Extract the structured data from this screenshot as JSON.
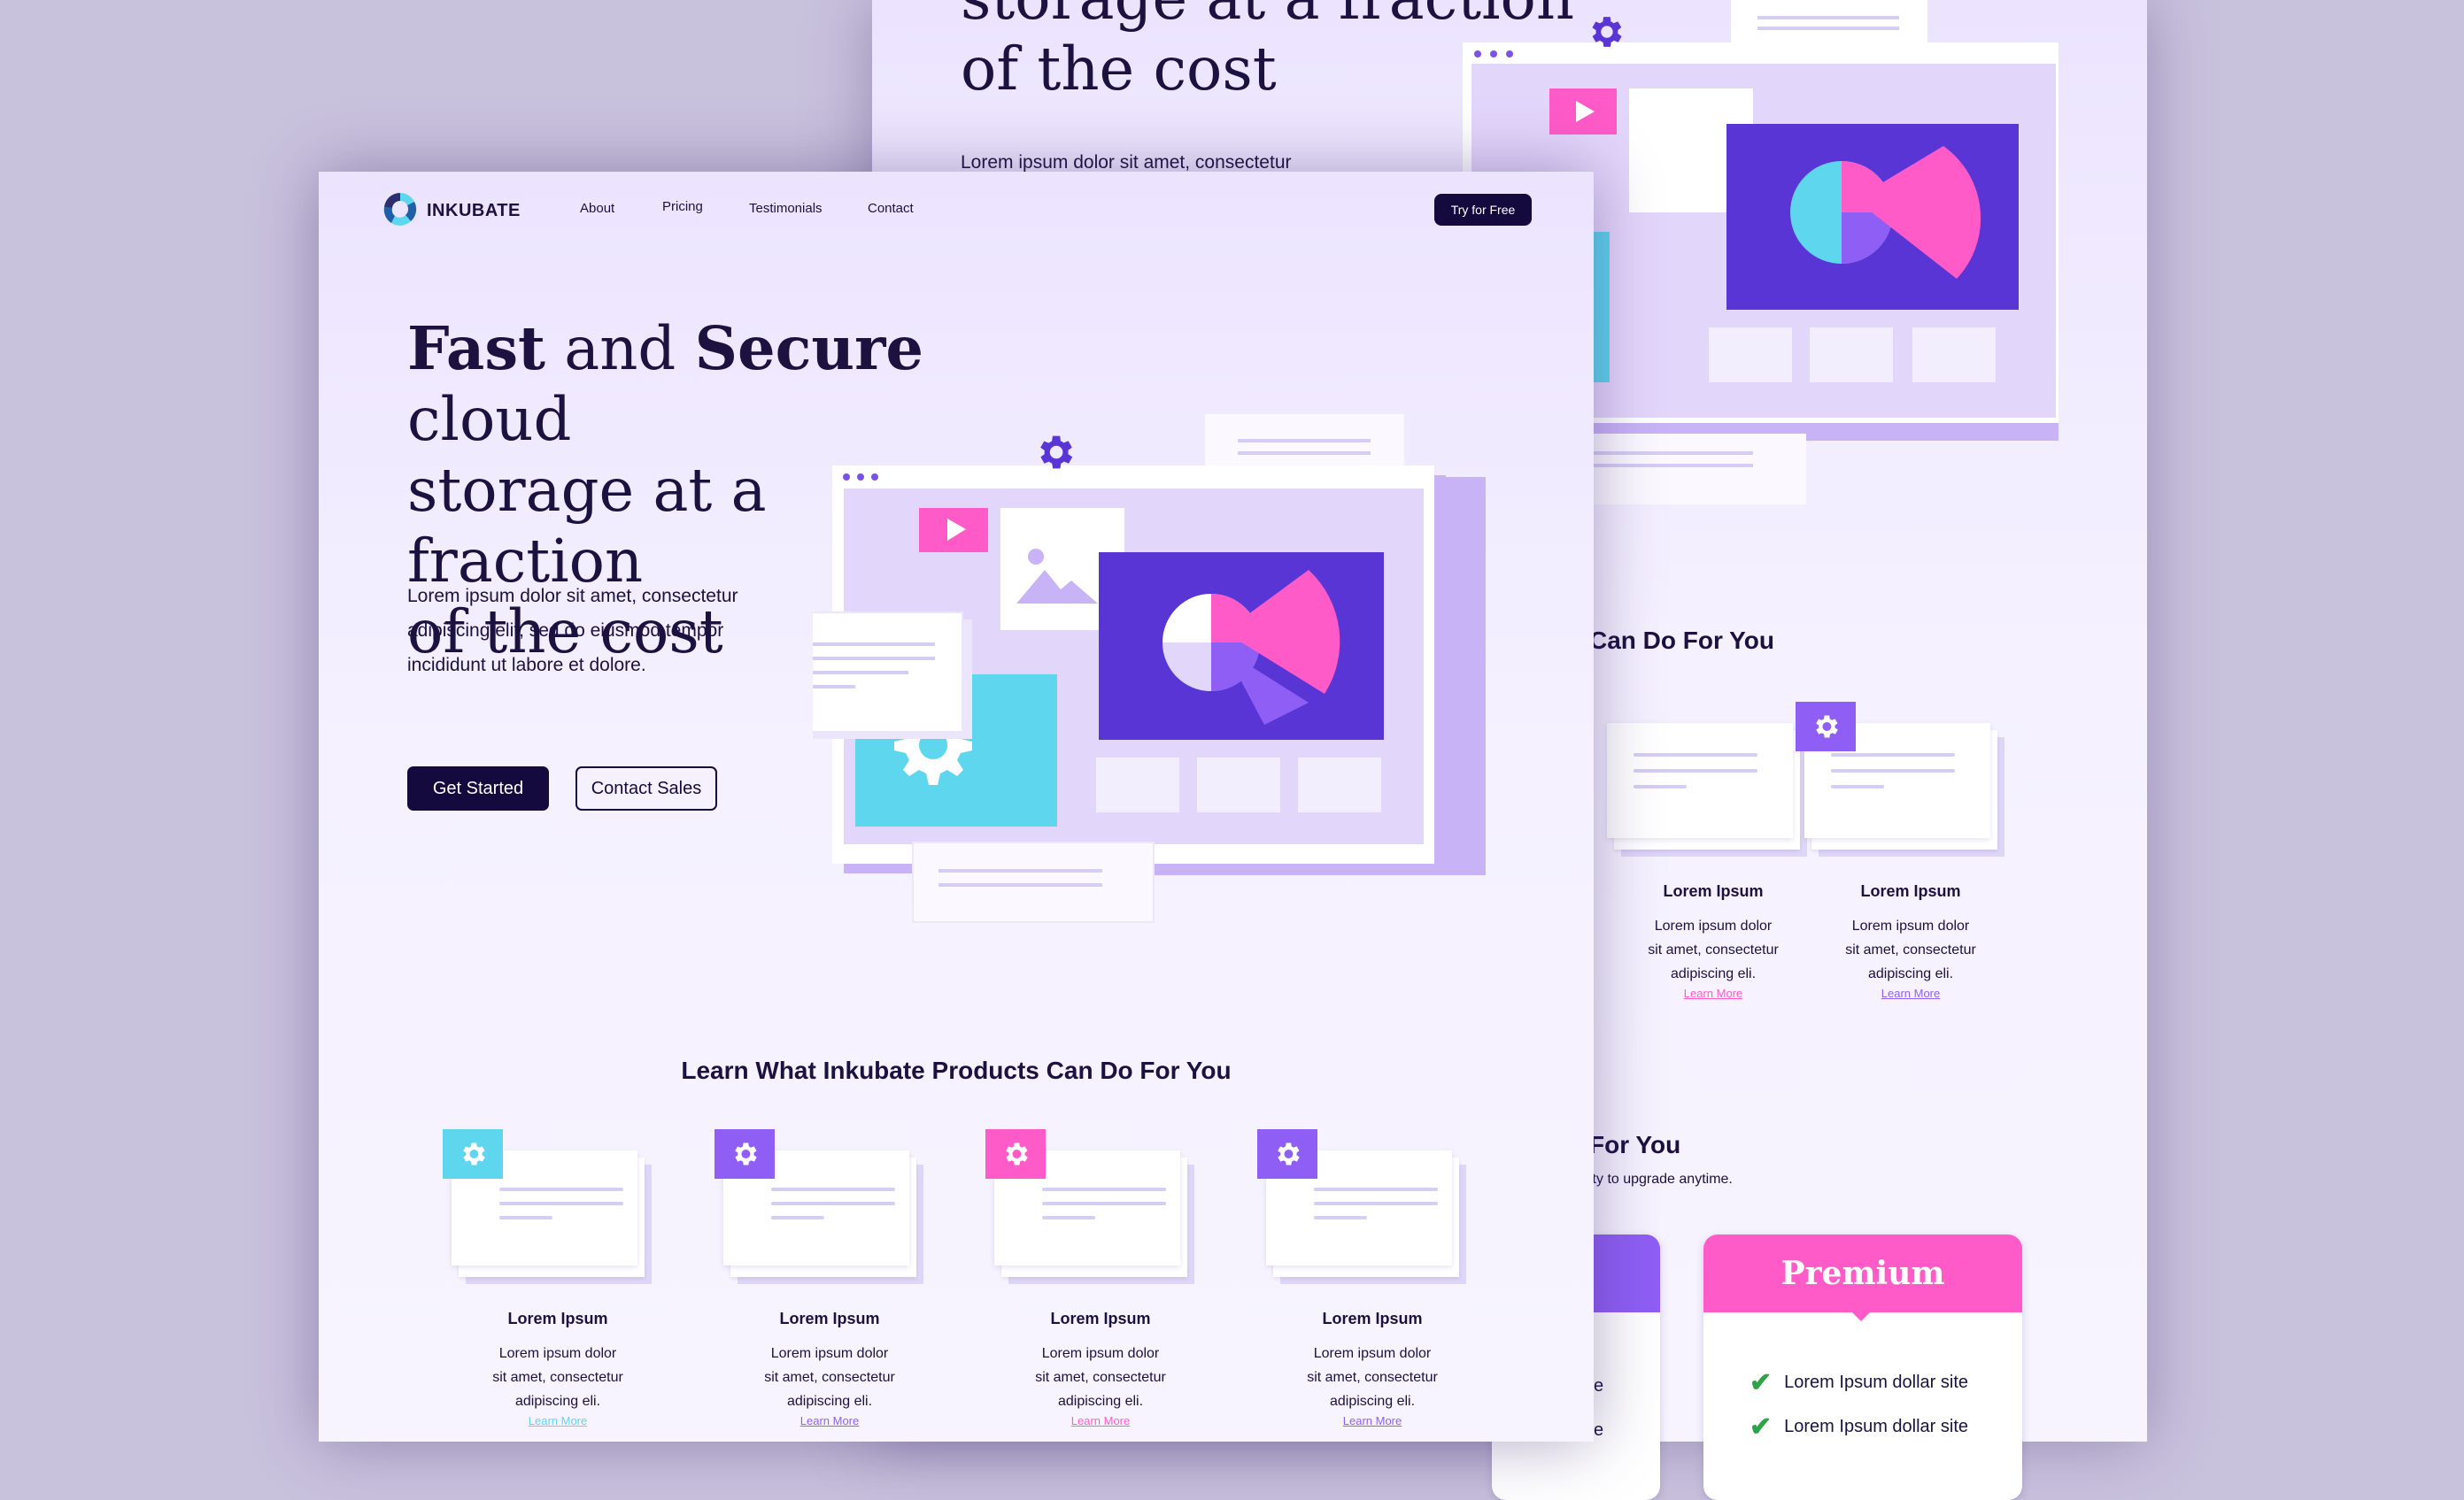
{
  "colors": {
    "background": "#c9c2dd",
    "page": "#efe9ff",
    "dark": "#150a3d",
    "purple": "#5a35d6",
    "cyan": "#5ed6ee",
    "pink": "#ff5bc8",
    "violet": "#8f5ff5",
    "lilac": "#e3d6fb"
  },
  "brand": {
    "name": "INKUBATE",
    "logo_icon": "inkubate-logo-icon"
  },
  "nav": {
    "items": [
      "About",
      "Pricing",
      "Testimonials",
      "Contact"
    ],
    "cta": "Try for Free"
  },
  "hero": {
    "title_bold_1": "Fast",
    "title_plain_1": " and ",
    "title_bold_2": "Secure",
    "title_plain_2": " cloud",
    "title_line_2": "storage at a fraction",
    "title_line_3": "of the cost",
    "description": "Lorem ipsum dolor sit amet, consectetur adipiscing elit, sed do eiusmod tempor incididunt ut labore et dolore.",
    "description_partial": "Lorem ipsum dolor sit amet, consectetur",
    "primary_button": "Get Started",
    "secondary_button": "Contact Sales"
  },
  "features": {
    "title": "Learn What Inkubate Products Can Do For You",
    "title_partial": "Can Do For You",
    "cards": [
      {
        "title": "Lorem Ipsum",
        "desc_1": "Lorem ipsum dolor",
        "desc_2": "sit amet, consectetur",
        "desc_3": "adipiscing eli.",
        "link": "Learn More",
        "color": "#5ed6ee",
        "icon": "gear-icon"
      },
      {
        "title": "Lorem Ipsum",
        "desc_1": "Lorem ipsum dolor",
        "desc_2": "sit amet, consectetur",
        "desc_3": "adipiscing eli.",
        "link": "Learn More",
        "color": "#8f5ff5",
        "icon": "gear-icon"
      },
      {
        "title": "Lorem Ipsum",
        "desc_1": "Lorem ipsum dolor",
        "desc_2": "sit amet, consectetur",
        "desc_3": "adipiscing eli.",
        "link": "Learn More",
        "color": "#ff5bc8",
        "icon": "gear-icon"
      },
      {
        "title": "Lorem Ipsum",
        "desc_1": "Lorem ipsum dolor",
        "desc_2": "sit amet, consectetur",
        "desc_3": "adipiscing eli.",
        "link": "Learn More",
        "color": "#8f5ff5",
        "icon": "gear-icon"
      }
    ]
  },
  "back_features": {
    "cards": [
      {
        "title": "Lorem Ipsum",
        "desc_1": "Lorem ipsum dolor",
        "desc_2": "sit amet, consectetur",
        "desc_3": "adipiscing eli.",
        "link": "Learn More"
      },
      {
        "title": "Lorem Ipsum",
        "desc_1": "Lorem ipsum dolor",
        "desc_2": "sit amet, consectetur",
        "desc_3": "adipiscing eli.",
        "link": "Learn More"
      }
    ]
  },
  "pricing": {
    "title_partial": "For You",
    "subtitle_partial": "ity to upgrade anytime.",
    "premium_label": "Premium",
    "feature_partial": "site",
    "features": [
      "Lorem Ipsum dollar site",
      "Lorem Ipsum dollar site"
    ]
  }
}
